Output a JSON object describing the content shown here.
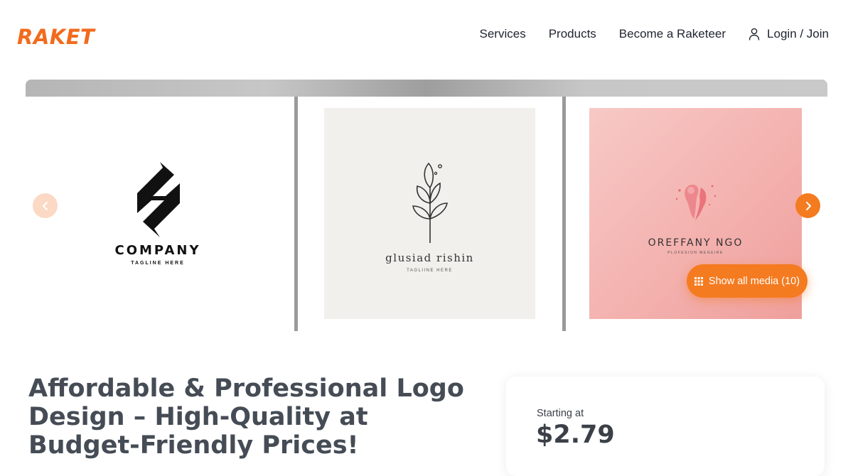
{
  "brand": {
    "logo_text": "RAKET",
    "color": "#f26b1d"
  },
  "nav": {
    "items": [
      {
        "label": "Services"
      },
      {
        "label": "Products"
      },
      {
        "label": "Become a Raketeer"
      }
    ],
    "login_label": "Login / Join",
    "login_icon": "user-icon"
  },
  "gallery": {
    "slides": [
      {
        "title": "COMPANY",
        "tagline": "TAGLINE HERE"
      },
      {
        "title": "glusiad rishin",
        "tagline": "TAGLIINE HERE"
      },
      {
        "title": "OREFFANY NGO",
        "tagline": "PLOFESION MEGEIRE"
      }
    ],
    "prev_icon": "chevron-left-icon",
    "next_icon": "chevron-right-icon",
    "show_all_label": "Show all media (10)",
    "show_all_icon": "grid-icon",
    "accent": "#f47b20"
  },
  "listing": {
    "headline": "Affordable & Professional Logo Design – High-Quality at Budget-Friendly Prices!",
    "price_label": "Starting at",
    "price_value": "$2.79"
  }
}
